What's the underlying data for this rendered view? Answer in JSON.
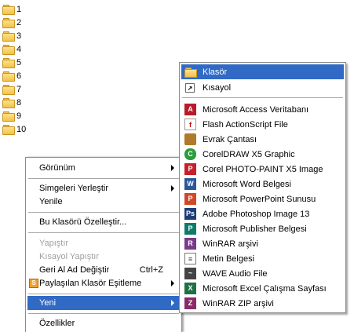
{
  "folders": [
    "1",
    "2",
    "3",
    "4",
    "5",
    "6",
    "7",
    "8",
    "9",
    "10"
  ],
  "context_menu": {
    "items": [
      {
        "label": "Görünüm",
        "submenu": true
      },
      {
        "label": "Simgeleri Yerleştir",
        "submenu": true
      },
      {
        "label": "Yenile"
      },
      {
        "label": "Bu Klasörü Özelleştir..."
      },
      {
        "label": "Yapıştır",
        "disabled": true
      },
      {
        "label": "Kısayol Yapıştır",
        "disabled": true
      },
      {
        "label": "Geri Al Ad Değiştir",
        "shortcut": "Ctrl+Z"
      },
      {
        "label": "Paylaşılan Klasör Eşitleme",
        "submenu": true
      },
      {
        "label": "Yeni",
        "submenu": true,
        "selected": true
      },
      {
        "label": "Özellikler"
      }
    ]
  },
  "new_submenu": {
    "items": [
      {
        "label": "Klasör",
        "icon": "folder-icon",
        "selected": true
      },
      {
        "label": "Kısayol",
        "icon": "shortcut-icon"
      },
      {
        "label": "Microsoft Access Veritabanı",
        "icon": "access-icon"
      },
      {
        "label": "Flash ActionScript File",
        "icon": "flash-icon"
      },
      {
        "label": "Evrak Çantası",
        "icon": "briefcase-icon"
      },
      {
        "label": "CorelDRAW X5 Graphic",
        "icon": "coreldraw-icon"
      },
      {
        "label": "Corel PHOTO-PAINT X5 Image",
        "icon": "photopaint-icon"
      },
      {
        "label": "Microsoft Word Belgesi",
        "icon": "word-icon"
      },
      {
        "label": "Microsoft PowerPoint Sunusu",
        "icon": "powerpoint-icon"
      },
      {
        "label": "Adobe Photoshop Image 13",
        "icon": "photoshop-icon"
      },
      {
        "label": "Microsoft Publisher Belgesi",
        "icon": "publisher-icon"
      },
      {
        "label": "WinRAR arşivi",
        "icon": "winrar-icon"
      },
      {
        "label": "Metin Belgesi",
        "icon": "text-document-icon"
      },
      {
        "label": "WAVE Audio File",
        "icon": "wave-audio-icon"
      },
      {
        "label": "Microsoft Excel Çalışma Sayfası",
        "icon": "excel-icon"
      },
      {
        "label": "WinRAR ZIP arşivi",
        "icon": "winrar-zip-icon"
      }
    ]
  }
}
